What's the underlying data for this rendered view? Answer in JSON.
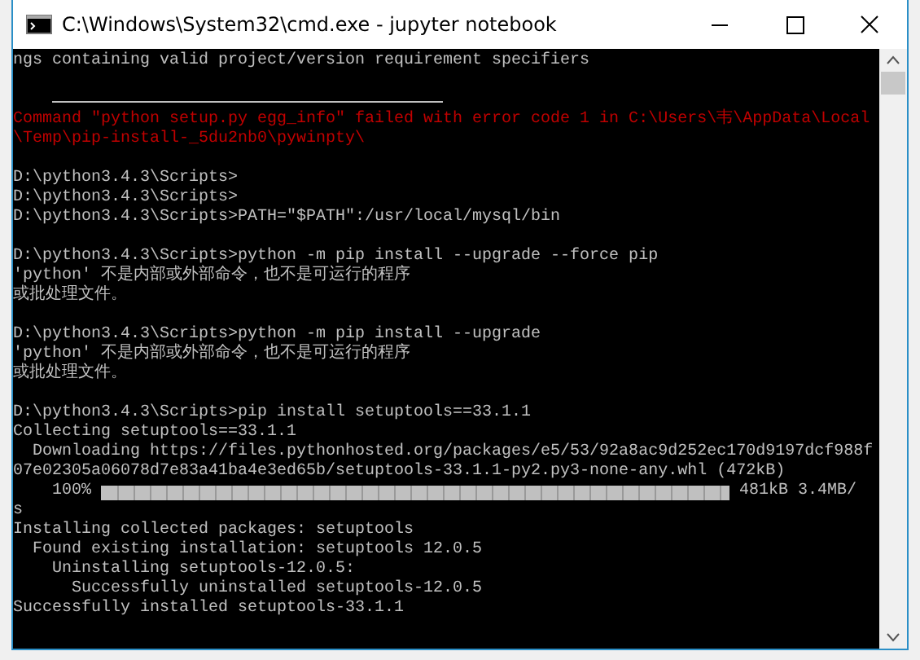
{
  "window": {
    "title": "C:\\Windows\\System32\\cmd.exe - jupyter  notebook"
  },
  "console": {
    "lines": [
      {
        "kind": "text",
        "text": "ngs containing valid project/version requirement specifiers"
      },
      {
        "kind": "blank"
      },
      {
        "kind": "rule"
      },
      {
        "kind": "error",
        "text": "Command \"python setup.py egg_info\" failed with error code 1 in C:\\Users\\韦\\AppData\\Local"
      },
      {
        "kind": "error",
        "text": "\\Temp\\pip-install-_5du2nb0\\pywinpty\\"
      },
      {
        "kind": "blank"
      },
      {
        "kind": "text",
        "text": "D:\\python3.4.3\\Scripts>"
      },
      {
        "kind": "text",
        "text": "D:\\python3.4.3\\Scripts>"
      },
      {
        "kind": "text",
        "text": "D:\\python3.4.3\\Scripts>PATH=\"$PATH\":/usr/local/mysql/bin"
      },
      {
        "kind": "blank"
      },
      {
        "kind": "text",
        "text": "D:\\python3.4.3\\Scripts>python -m pip install --upgrade --force pip"
      },
      {
        "kind": "text",
        "text": "'python' 不是内部或外部命令，也不是可运行的程序"
      },
      {
        "kind": "text",
        "text": "或批处理文件。"
      },
      {
        "kind": "blank"
      },
      {
        "kind": "text",
        "text": "D:\\python3.4.3\\Scripts>python -m pip install --upgrade"
      },
      {
        "kind": "text",
        "text": "'python' 不是内部或外部命令，也不是可运行的程序"
      },
      {
        "kind": "text",
        "text": "或批处理文件。"
      },
      {
        "kind": "blank"
      },
      {
        "kind": "text",
        "text": "D:\\python3.4.3\\Scripts>pip install setuptools==33.1.1"
      },
      {
        "kind": "text",
        "text": "Collecting setuptools==33.1.1"
      },
      {
        "kind": "text",
        "text": "  Downloading https://files.pythonhosted.org/packages/e5/53/92a8ac9d252ec170d9197dcf988f"
      },
      {
        "kind": "text",
        "text": "07e02305a06078d7e83a41ba4e3ed65b/setuptools-33.1.1-py2.py3-none-any.whl (472kB)"
      },
      {
        "kind": "progress",
        "text": "100%",
        "level": 1,
        "reading": "481kB 3.4MB/"
      },
      {
        "kind": "text",
        "text": "s"
      },
      {
        "kind": "text",
        "text": "Installing collected packages: setuptools"
      },
      {
        "kind": "text",
        "text": "  Found existing installation: setuptools 12.0.5"
      },
      {
        "kind": "text",
        "text": "    Uninstalling setuptools-12.0.5:"
      },
      {
        "kind": "text",
        "text": "      Successfully uninstalled setuptools-12.0.5"
      },
      {
        "kind": "text",
        "text": "Successfully installed setuptools-33.1.1"
      }
    ]
  }
}
